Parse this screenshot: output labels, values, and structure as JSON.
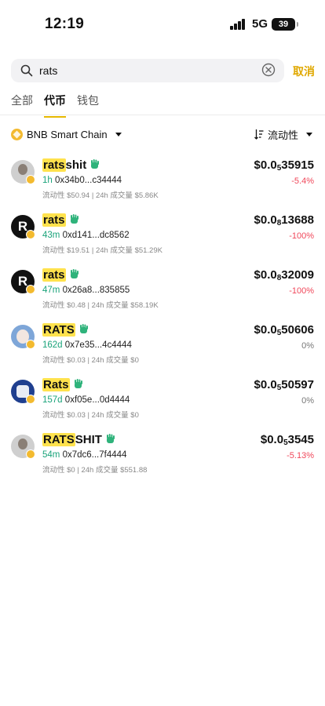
{
  "status_bar": {
    "time": "12:19",
    "network": "5G",
    "battery": "39"
  },
  "search": {
    "query": "rats",
    "cancel_label": "取消"
  },
  "tabs": [
    {
      "label": "全部",
      "active": false
    },
    {
      "label": "代币",
      "active": true
    },
    {
      "label": "钱包",
      "active": false
    }
  ],
  "filters": {
    "chain": "BNB Smart Chain",
    "sort": "流动性"
  },
  "tokens": [
    {
      "avatar": "gray",
      "avatar_letter": "",
      "name_highlight": "rats",
      "name_rest": "shit",
      "age": "1h",
      "address": "0x34b0...c34444",
      "stats": "流动性 $50.94 | 24h 成交量 $5.86K",
      "price_prefix": "$0.0",
      "price_zeros": "5",
      "price_digits": "35915",
      "change": "-5.4%",
      "change_type": "neg"
    },
    {
      "avatar": "black",
      "avatar_letter": "R",
      "name_highlight": "rats",
      "name_rest": "",
      "age": "43m",
      "address": "0xd141...dc8562",
      "stats": "流动性 $19.51 | 24h 成交量 $51.29K",
      "price_prefix": "$0.0",
      "price_zeros": "8",
      "price_digits": "13688",
      "change": "-100%",
      "change_type": "neg"
    },
    {
      "avatar": "black",
      "avatar_letter": "R",
      "name_highlight": "rats",
      "name_rest": "",
      "age": "47m",
      "address": "0x26a8...835855",
      "stats": "流动性 $0.48 | 24h 成交量 $58.19K",
      "price_prefix": "$0.0",
      "price_zeros": "8",
      "price_digits": "32009",
      "change": "-100%",
      "change_type": "neg"
    },
    {
      "avatar": "blue",
      "avatar_letter": "",
      "name_highlight": "RATS",
      "name_rest": "",
      "age": "162d",
      "address": "0x7e35...4c4444",
      "stats": "流动性 $0.03 | 24h 成交量 $0",
      "price_prefix": "$0.0",
      "price_zeros": "5",
      "price_digits": "50606",
      "change": "0%",
      "change_type": "neutral"
    },
    {
      "avatar": "navy",
      "avatar_letter": "",
      "name_highlight": "Rats",
      "name_rest": "",
      "age": "157d",
      "address": "0xf05e...0d4444",
      "stats": "流动性 $0.03 | 24h 成交量 $0",
      "price_prefix": "$0.0",
      "price_zeros": "5",
      "price_digits": "50597",
      "change": "0%",
      "change_type": "neutral"
    },
    {
      "avatar": "gray",
      "avatar_letter": "",
      "name_highlight": "RATS",
      "name_rest": "SHIT",
      "age": "54m",
      "address": "0x7dc6...7f4444",
      "stats": "流动性 $0 | 24h 成交量 $551.88",
      "price_prefix": "$0.0",
      "price_zeros": "5",
      "price_digits": "3545",
      "change": "-5.13%",
      "change_type": "neg"
    }
  ],
  "colors": {
    "accent": "#e0a800",
    "highlight": "#ffe24d",
    "positive_age": "#1aa37a",
    "negative": "#f0475a",
    "bnb": "#f3ba2f"
  }
}
